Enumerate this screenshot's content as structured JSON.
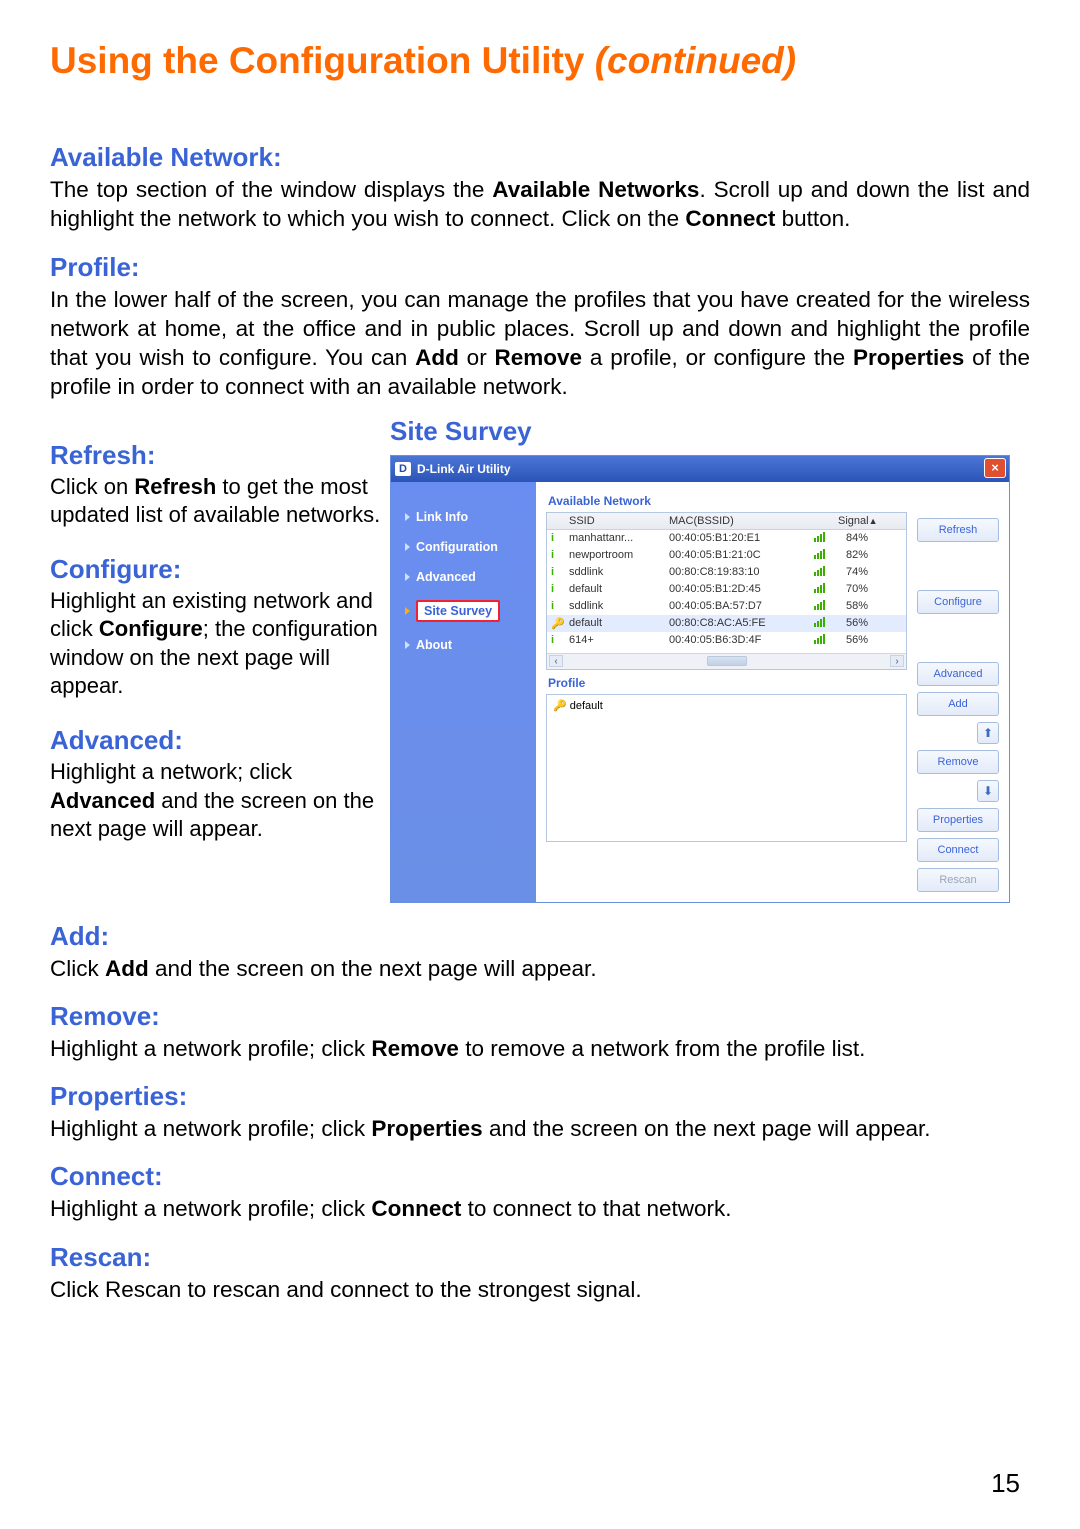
{
  "page": {
    "title_main": "Using the Configuration Utility ",
    "title_cont": "(continued)",
    "number": "15"
  },
  "sections": {
    "avail_h": "Available Network:",
    "avail_t1": "The top section of the window displays the ",
    "avail_b1": "Available Networks",
    "avail_t2": ". Scroll up and down the list and highlight the network to which you wish to connect. Click on the ",
    "avail_b2": "Connect",
    "avail_t3": " button.",
    "profile_h": "Profile:",
    "profile_t1": "In the lower half of the screen, you can manage the profiles that you have created for the wireless network at home, at the office and in public places. Scroll up and down and highlight the profile that you wish to configure. You can ",
    "profile_b1": "Add",
    "profile_t2": " or ",
    "profile_b2": "Remove",
    "profile_t3": " a profile, or configure the ",
    "profile_b3": "Properties",
    "profile_t4": " of the profile in order to connect with an available network.",
    "refresh_h": "Refresh:",
    "refresh_t1": "Click on ",
    "refresh_b1": "Refresh",
    "refresh_t2": " to get the most updated list of available networks.",
    "configure_h": "Configure:",
    "configure_t1": "Highlight an existing network and click ",
    "configure_b1": "Configure",
    "configure_t2": "; the configuration window on the next page will appear.",
    "advanced_h": "Advanced:",
    "advanced_t1": "Highlight a network; click ",
    "advanced_b1": "Advanced",
    "advanced_t2": " and the screen on the next page will appear.",
    "add_h": "Add:",
    "add_t1": "Click ",
    "add_b1": "Add",
    "add_t2": " and the screen on the next page will appear.",
    "remove_h": "Remove:",
    "remove_t1": "Highlight a network profile; click ",
    "remove_b1": "Remove",
    "remove_t2": " to remove a network from the profile list.",
    "properties_h": "Properties:",
    "properties_t1": "Highlight a network profile; click ",
    "properties_b1": "Properties",
    "properties_t2": " and the screen on the next page will appear.",
    "connect_h": "Connect:",
    "connect_t1": "Highlight a network profile; click ",
    "connect_b1": "Connect",
    "connect_t2": " to connect to that network.",
    "rescan_h": "Rescan:",
    "rescan_t": "Click Rescan to rescan and connect to the strongest signal."
  },
  "survey_title": "Site Survey",
  "window": {
    "title": "D-Link Air Utility",
    "close": "×",
    "tabs": [
      "Link Info",
      "Configuration",
      "Advanced",
      "Site Survey",
      "About"
    ],
    "selected_tab": 3,
    "avail_heading": "Available Network",
    "cols": {
      "ssid": "SSID",
      "mac": "MAC(BSSID)",
      "signal": "Signal"
    },
    "rows": [
      {
        "icon": "i",
        "ssid": "manhattanr...",
        "mac": "00:40:05:B1:20:E1",
        "pct": "84%",
        "sel": false
      },
      {
        "icon": "i",
        "ssid": "newportroom",
        "mac": "00:40:05:B1:21:0C",
        "pct": "82%",
        "sel": false
      },
      {
        "icon": "i",
        "ssid": "sddlink",
        "mac": "00:80:C8:19:83:10",
        "pct": "74%",
        "sel": false
      },
      {
        "icon": "i",
        "ssid": "default",
        "mac": "00:40:05:B1:2D:45",
        "pct": "70%",
        "sel": false
      },
      {
        "icon": "i",
        "ssid": "sddlink",
        "mac": "00:40:05:BA:57:D7",
        "pct": "58%",
        "sel": false
      },
      {
        "icon": "k",
        "ssid": "default",
        "mac": "00:80:C8:AC:A5:FE",
        "pct": "56%",
        "sel": true
      },
      {
        "icon": "i",
        "ssid": "614+",
        "mac": "00:40:05:B6:3D:4F",
        "pct": "56%",
        "sel": false
      }
    ],
    "profile_heading": "Profile",
    "profile_item": "default",
    "buttons": {
      "refresh": "Refresh",
      "configure": "Configure",
      "advanced": "Advanced",
      "add": "Add",
      "remove": "Remove",
      "properties": "Properties",
      "connect": "Connect",
      "rescan": "Rescan"
    }
  }
}
